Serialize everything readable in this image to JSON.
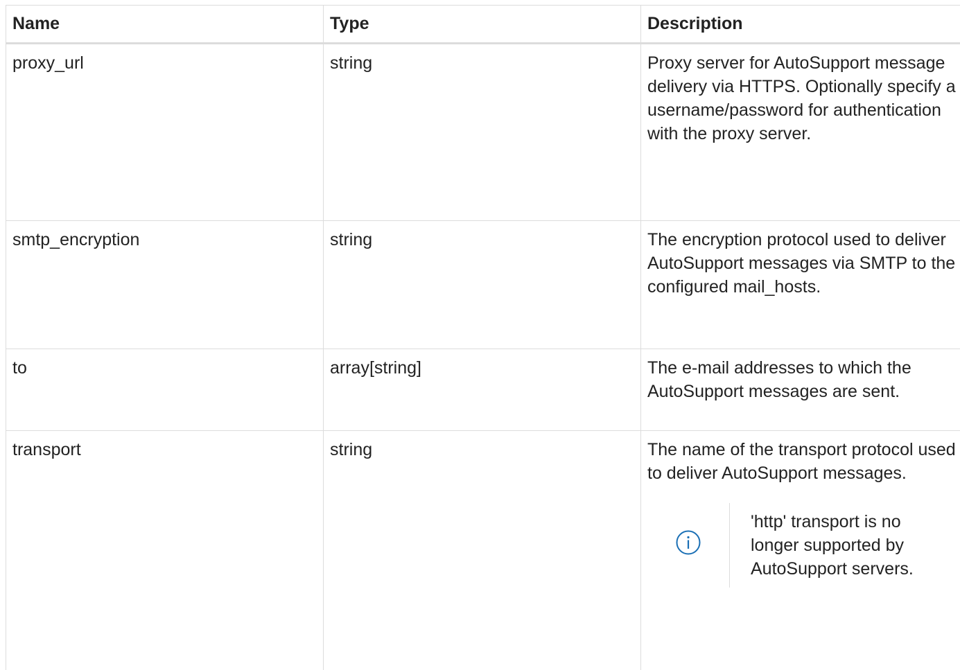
{
  "table": {
    "headers": {
      "name": "Name",
      "type": "Type",
      "description": "Description"
    },
    "rows": [
      {
        "name": "proxy_url",
        "type": "string",
        "description": "Proxy server for AutoSupport message delivery via HTTPS. Optionally specify a username/password for authentication with the proxy server."
      },
      {
        "name": "smtp_encryption",
        "type": "string",
        "description": "The encryption protocol used to deliver AutoSupport messages via SMTP to the configured mail_hosts."
      },
      {
        "name": "to",
        "type": "array[string]",
        "description": "The e-mail addresses to which the AutoSupport messages are sent."
      },
      {
        "name": "transport",
        "type": "string",
        "description": "The name of the transport protocol used to deliver AutoSupport messages.",
        "note": {
          "icon": "info-icon",
          "text": "'http' transport is no longer supported by AutoSupport servers."
        }
      }
    ]
  },
  "colors": {
    "border": "#dcdcdc",
    "text": "#222222",
    "info_icon": "#1a6fb5"
  }
}
